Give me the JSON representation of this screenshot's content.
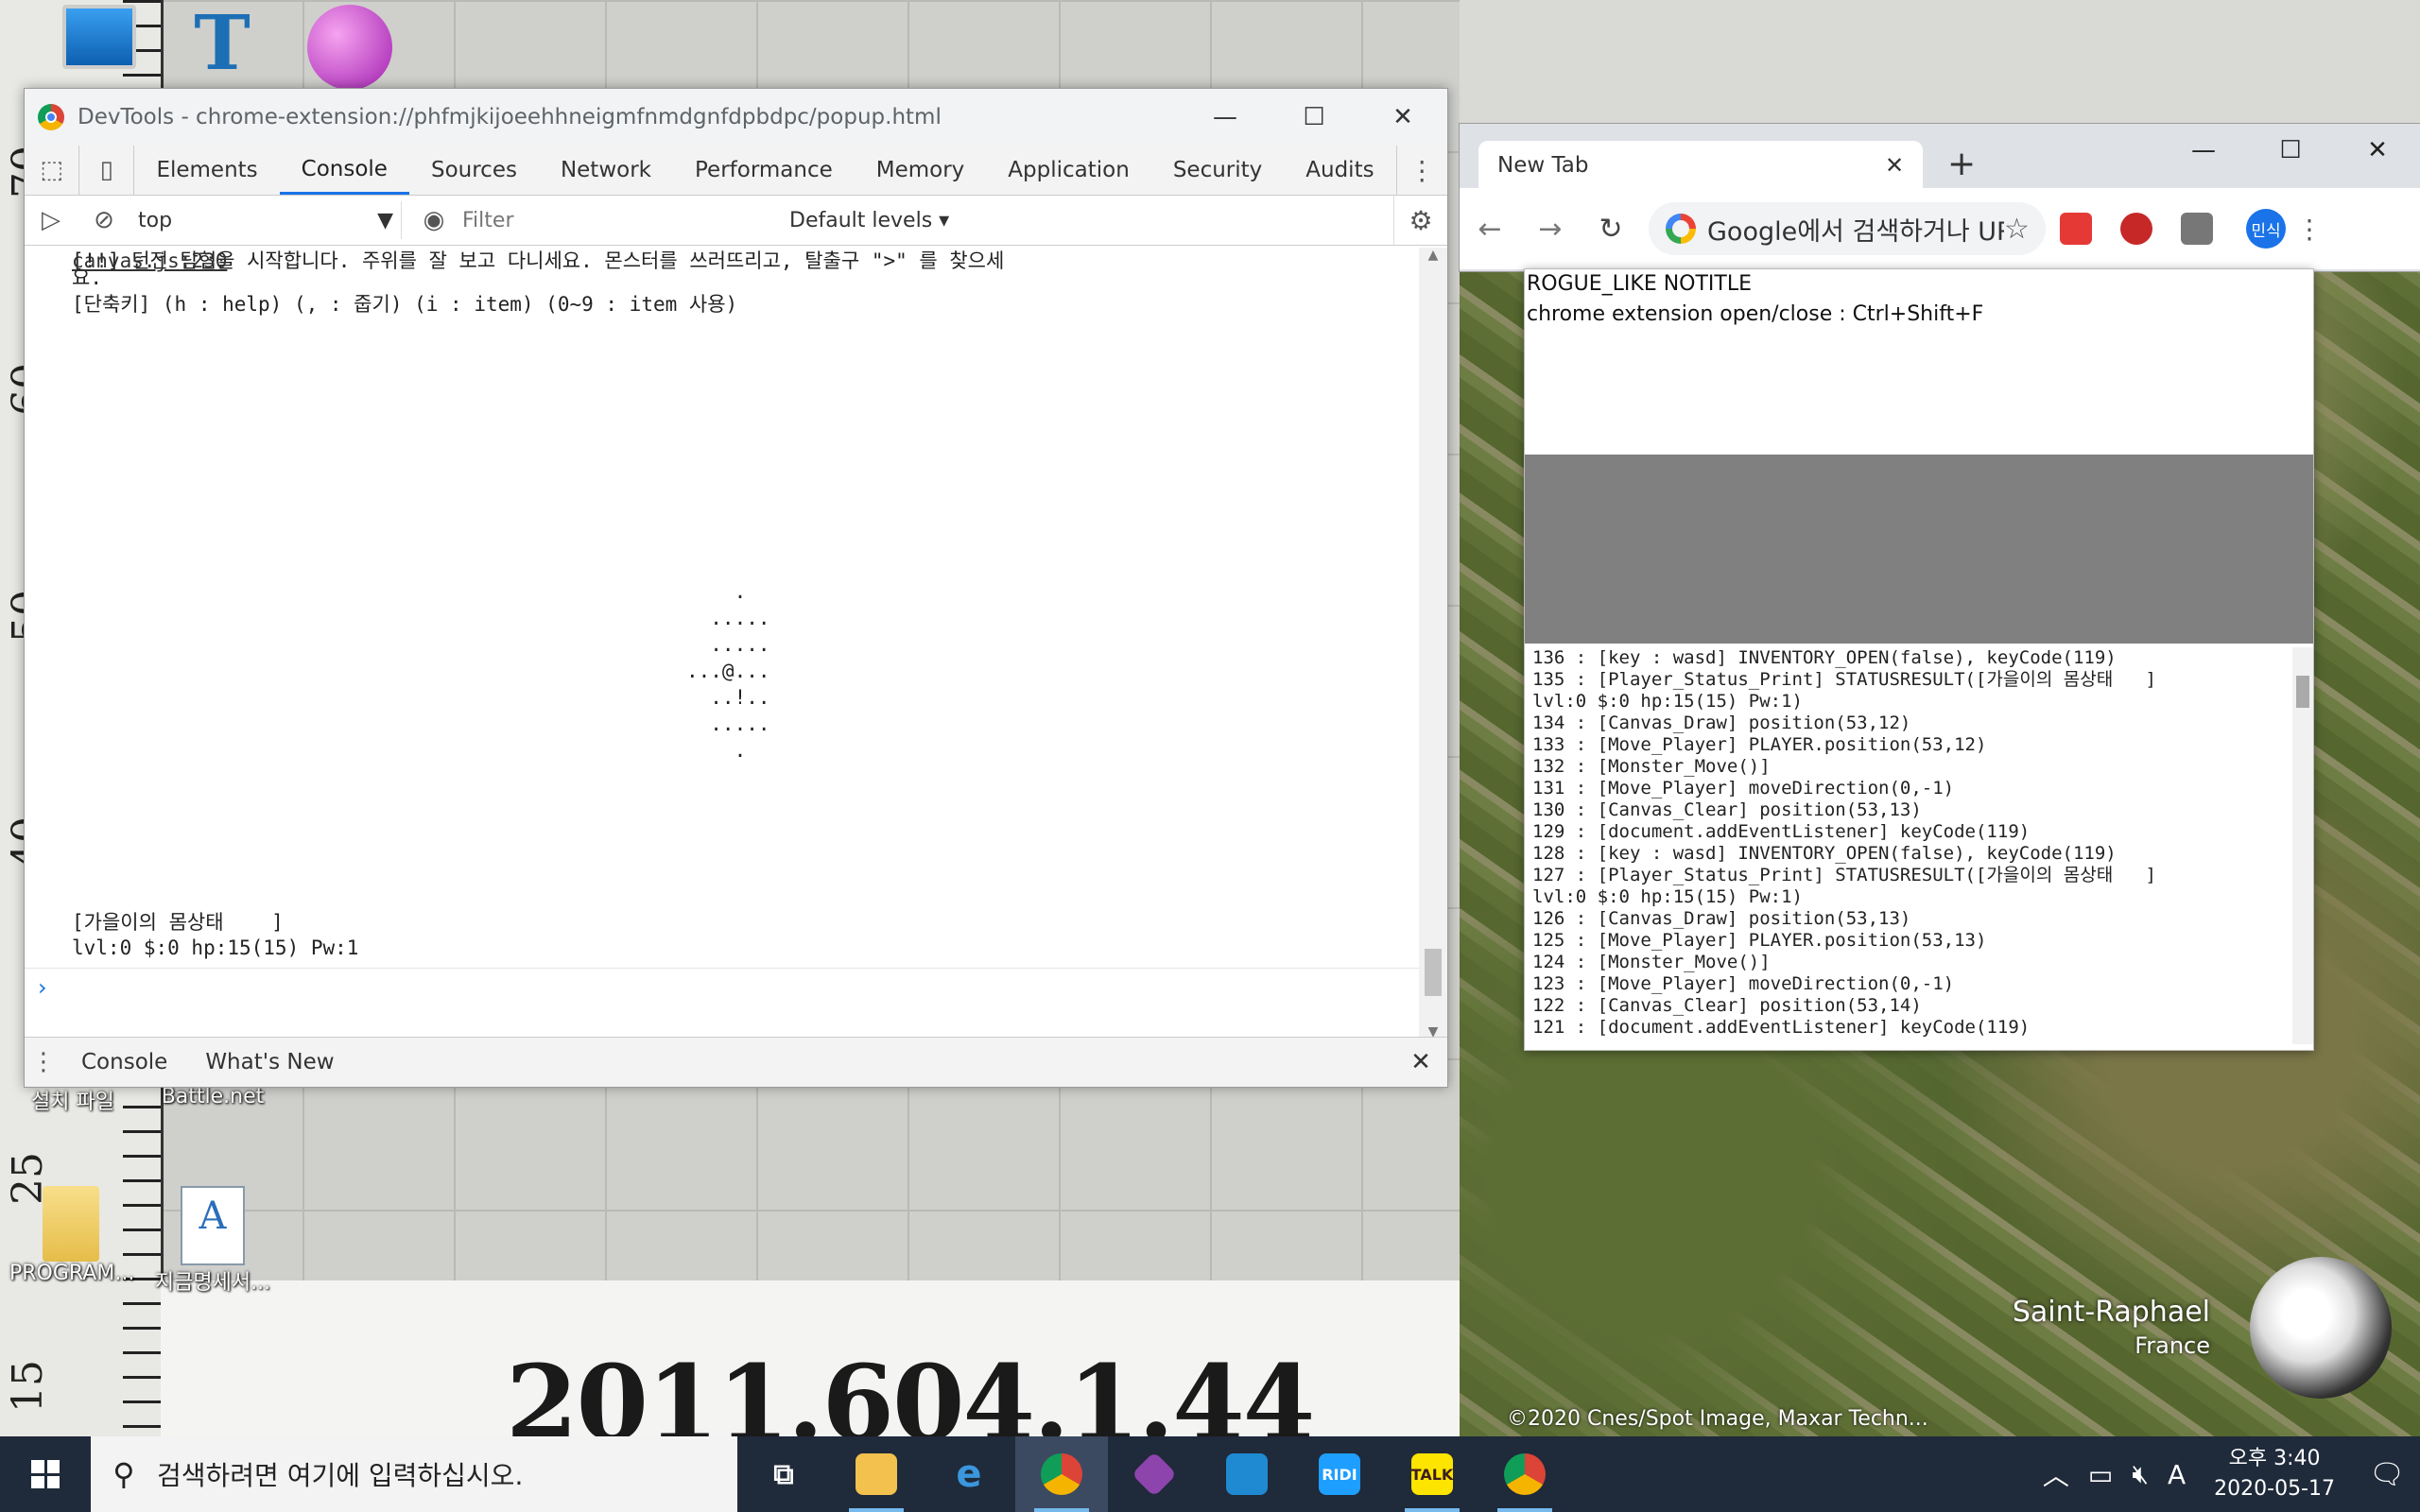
{
  "desktop": {
    "ruler_numbers": [
      "70",
      "60",
      "50",
      "40",
      "25",
      "15"
    ],
    "paper_number": "2011.604.1.44",
    "icons": [
      {
        "label": "설치 파일",
        "icon": "folder-icon"
      },
      {
        "label": "Battle.net",
        "icon": "battlenet-icon"
      },
      {
        "label": "PROGRAM...",
        "icon": "folder-icon"
      },
      {
        "label": "지금명세서...",
        "icon": "document-icon"
      }
    ]
  },
  "devtools": {
    "title": "DevTools - chrome-extension://phfmjkijoeehhneigmfnmdgnfdpbdpc/popup.html",
    "tabs": [
      "Elements",
      "Console",
      "Sources",
      "Network",
      "Performance",
      "Memory",
      "Application",
      "Security",
      "Audits"
    ],
    "active_tab": "Console",
    "context": "top",
    "filter_placeholder": "Filter",
    "levels": "Default levels ▾",
    "console": {
      "line1": "[!!] 던전 탐험을 시작합니다. 주위를 잘 보고 다니세요. 몬스터를 쓰러뜨리고, 탈출구 \">\" 를 찾으세",
      "line1b": "요.",
      "line2": "[단축키] (h : help) (, : 줍기) (i : item) (0~9 : item 사용)",
      "source": "canvas.js:230",
      "dungeon": "    .\n  .....\n  .....\n...@...\n  ..!..\n  .....\n    .",
      "status1": "[가을이의 몸상태    ]",
      "status2": "lvl:0 $:0 hp:15(15) Pw:1"
    },
    "drawer_tabs": [
      "Console",
      "What's New"
    ]
  },
  "chrome": {
    "tab_title": "New Tab",
    "omnibox": "Google에서 검색하거나 URL 입력",
    "profile": "민식"
  },
  "popup": {
    "title": "ROGUE_LIKE NOTITLE",
    "shortcut": "chrome extension open/close : Ctrl+Shift+F",
    "log": [
      "136 : [key : wasd] INVENTORY_OPEN(false), keyCode(119)",
      "135 : [Player_Status_Print] STATUSRESULT([가을이의 몸상태   ]",
      "lvl:0 $:0 hp:15(15) Pw:1)",
      "134 : [Canvas_Draw] position(53,12)",
      "133 : [Move_Player] PLAYER.position(53,12)",
      "132 : [Monster_Move()]",
      "131 : [Move_Player] moveDirection(0,-1)",
      "130 : [Canvas_Clear] position(53,13)",
      "129 : [document.addEventListener] keyCode(119)",
      "128 : [key : wasd] INVENTORY_OPEN(false), keyCode(119)",
      "127 : [Player_Status_Print] STATUSRESULT([가을이의 몸상태   ]",
      "lvl:0 $:0 hp:15(15) Pw:1)",
      "126 : [Canvas_Draw] position(53,13)",
      "125 : [Move_Player] PLAYER.position(53,13)",
      "124 : [Monster_Move()]",
      "123 : [Move_Player] moveDirection(0,-1)",
      "122 : [Canvas_Clear] position(53,14)",
      "121 : [document.addEventListener] keyCode(119)"
    ]
  },
  "map": {
    "city": "Saint-Raphael",
    "country": "France",
    "credit": "©2020 Cnes/Spot Image, Maxar Techn..."
  },
  "taskbar": {
    "search_placeholder": "검색하려면 여기에 입력하십시오.",
    "apps": [
      {
        "name": "task-view-icon",
        "label": ""
      },
      {
        "name": "file-explorer-icon",
        "label": ""
      },
      {
        "name": "edge-icon",
        "label": ""
      },
      {
        "name": "chrome-icon",
        "label": ""
      },
      {
        "name": "git-icon",
        "label": ""
      },
      {
        "name": "vscode-icon",
        "label": ""
      },
      {
        "name": "ridi-icon",
        "label": "RIDI"
      },
      {
        "name": "kakaotalk-icon",
        "label": "TALK"
      },
      {
        "name": "chrome-icon",
        "label": ""
      }
    ],
    "ime": "A",
    "time": "오후 3:40",
    "date": "2020-05-17"
  }
}
